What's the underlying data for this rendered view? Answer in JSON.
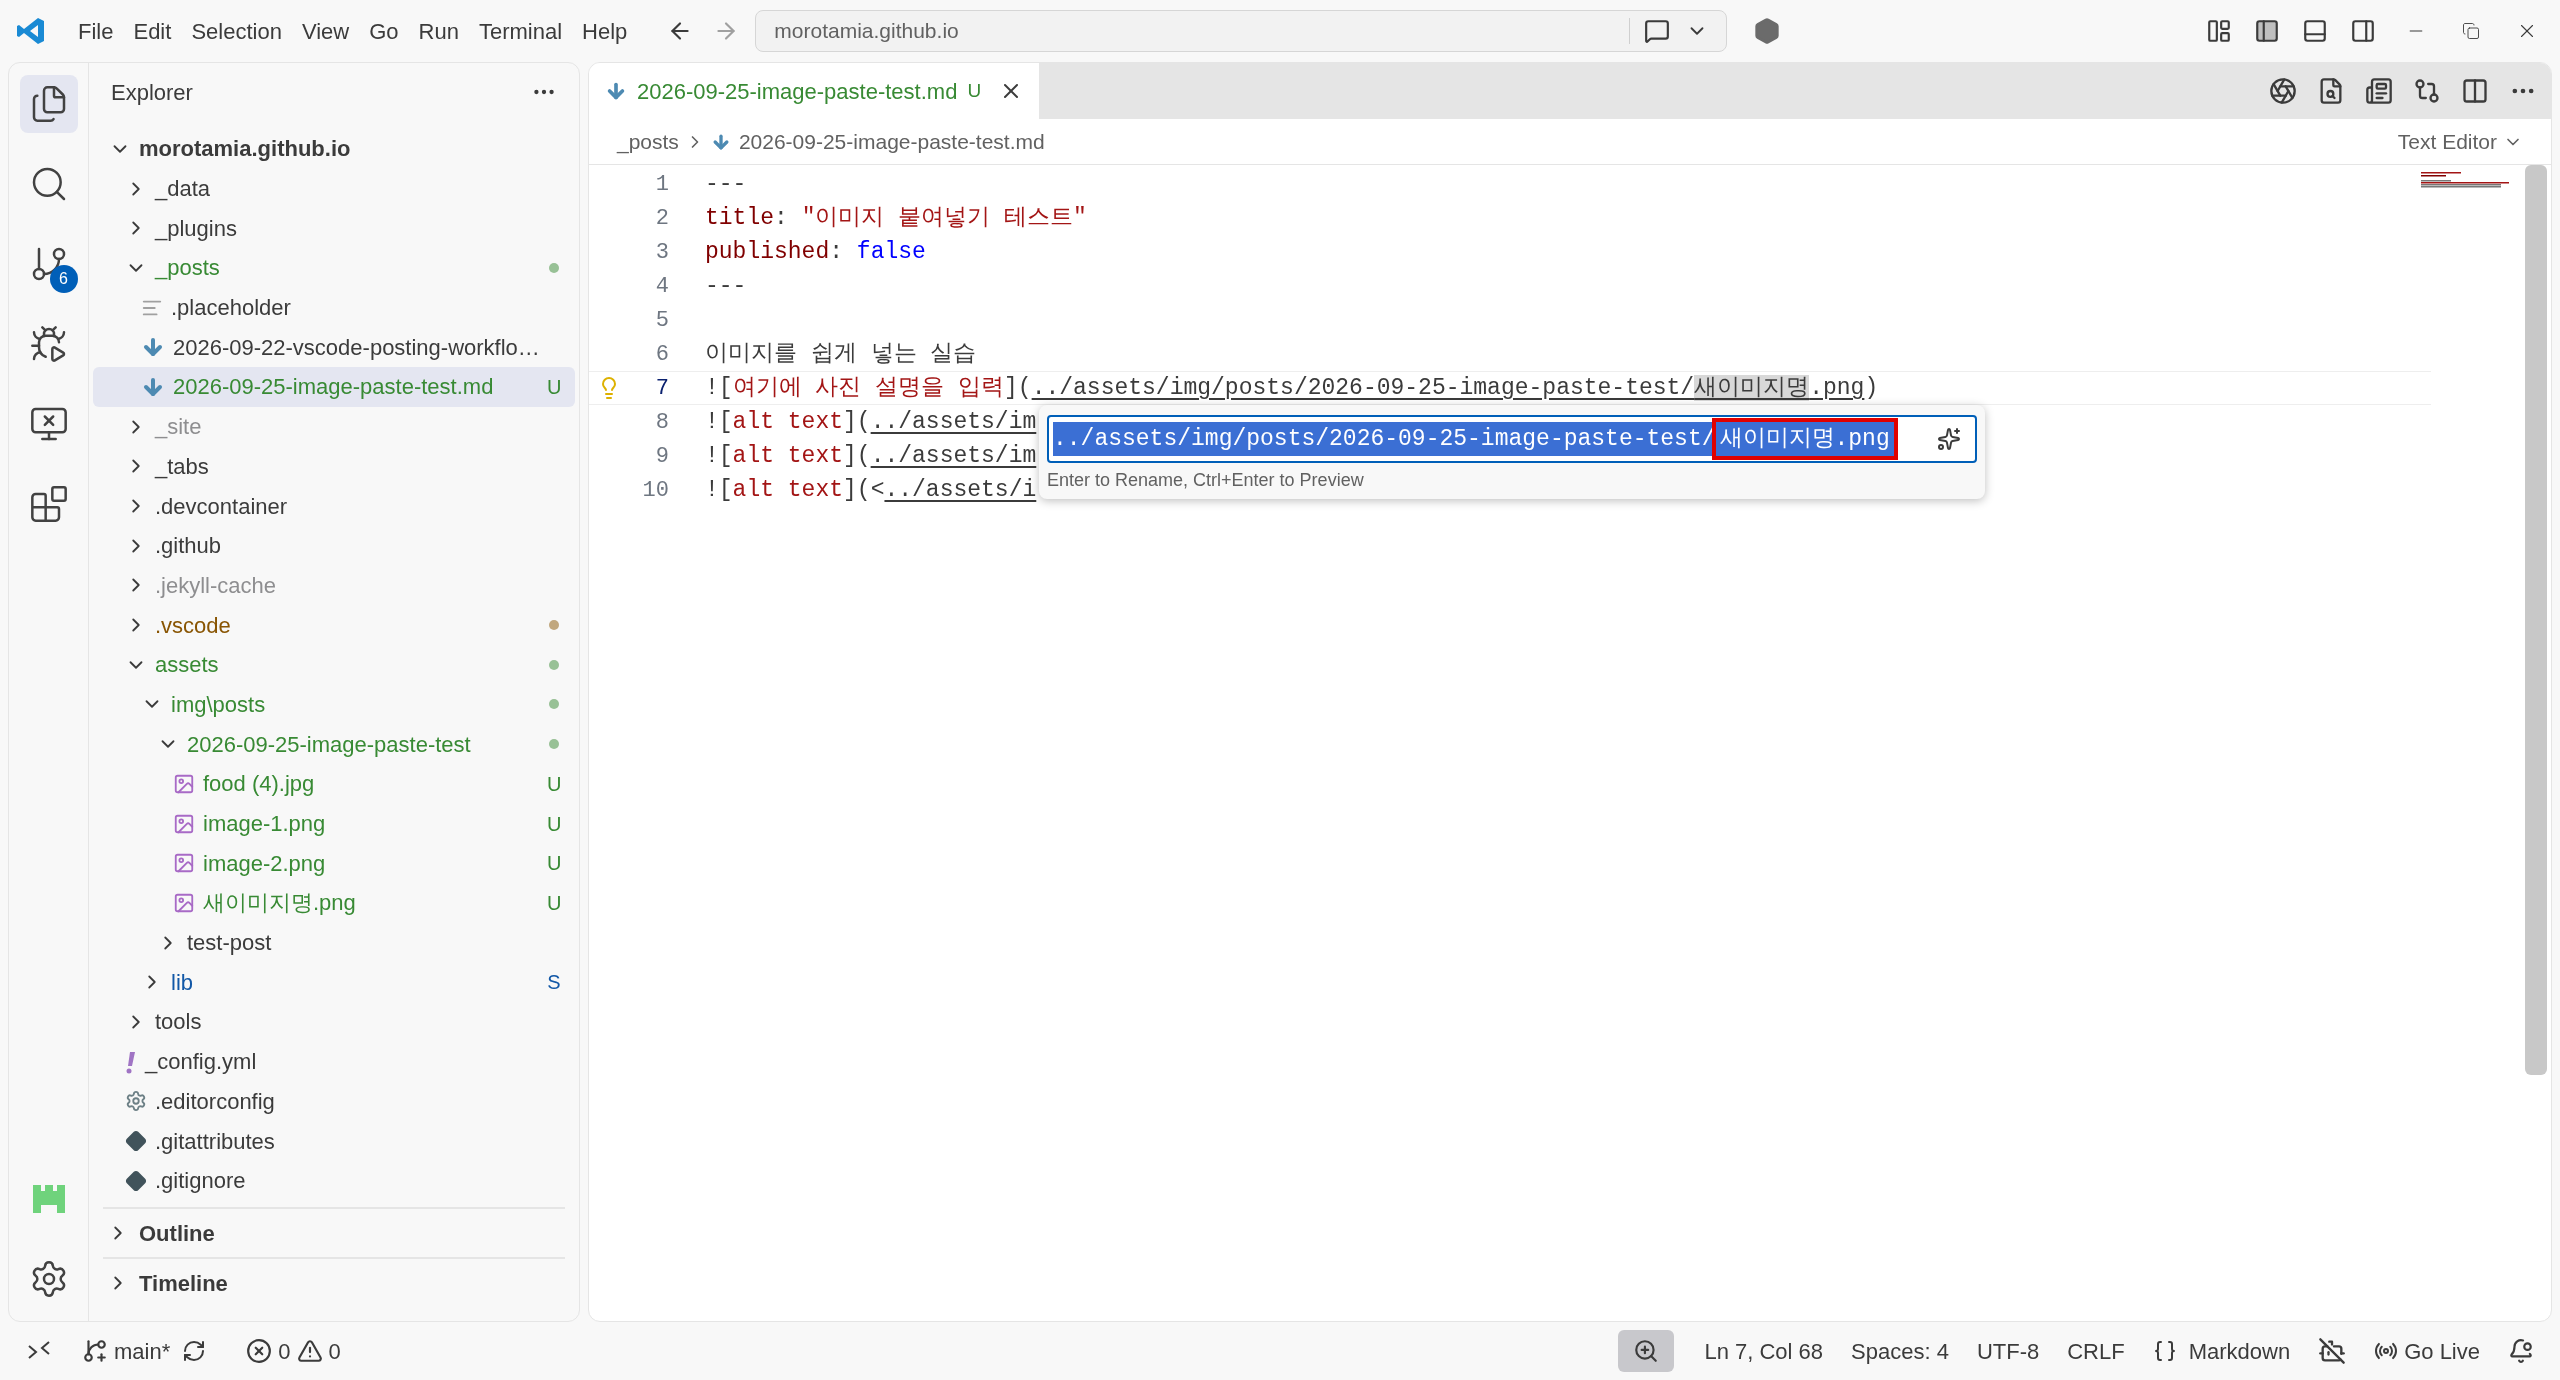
{
  "title_bar": {
    "menus": [
      "File",
      "Edit",
      "Selection",
      "View",
      "Go",
      "Run",
      "Terminal",
      "Help"
    ],
    "command_center": {
      "value": "morotamia.github.io"
    }
  },
  "activity_bar": {
    "items": [
      {
        "kind": "explorer",
        "selected": true
      },
      {
        "kind": "search",
        "selected": false
      },
      {
        "kind": "source-control",
        "selected": false,
        "badge": "6"
      },
      {
        "kind": "run-debug",
        "selected": false
      },
      {
        "kind": "remote",
        "selected": false
      },
      {
        "kind": "extensions",
        "selected": false
      }
    ]
  },
  "sidebar": {
    "title": "Explorer",
    "tree": [
      {
        "name": "morotamia.github.io",
        "kind": "root",
        "expanded": true,
        "selected": false,
        "children": [
          {
            "name": "_data",
            "kind": "folder",
            "expanded": false,
            "selected": false
          },
          {
            "name": "_plugins",
            "kind": "folder",
            "expanded": false,
            "selected": false
          },
          {
            "name": "_posts",
            "kind": "folder",
            "expanded": true,
            "selected": false,
            "color": "#388a34",
            "dot": true,
            "children": [
              {
                "name": ".placeholder",
                "kind": "text-file",
                "selected": false
              },
              {
                "name": "2026-09-22-vscode-posting-workflo…",
                "kind": "markdown-file",
                "selected": false
              },
              {
                "name": "2026-09-25-image-paste-test.md",
                "kind": "markdown-file",
                "selected": true,
                "color": "#388a34",
                "badge": "U"
              }
            ]
          },
          {
            "name": "_site",
            "kind": "folder",
            "expanded": false,
            "selected": false,
            "color": "#8e8e90"
          },
          {
            "name": "_tabs",
            "kind": "folder",
            "expanded": false,
            "selected": false
          },
          {
            "name": ".devcontainer",
            "kind": "folder",
            "expanded": false,
            "selected": false
          },
          {
            "name": ".github",
            "kind": "folder",
            "expanded": false,
            "selected": false
          },
          {
            "name": ".jekyll-cache",
            "kind": "folder",
            "expanded": false,
            "selected": false,
            "color": "#8e8e90"
          },
          {
            "name": ".vscode",
            "kind": "folder",
            "expanded": false,
            "selected": false,
            "color": "#895503",
            "dot": true
          },
          {
            "name": "assets",
            "kind": "folder",
            "expanded": true,
            "selected": false,
            "color": "#388a34",
            "dot": true,
            "children": [
              {
                "name": "img\\posts",
                "kind": "folder",
                "expanded": true,
                "selected": false,
                "color": "#388a34",
                "dot": true,
                "children": [
                  {
                    "name": "2026-09-25-image-paste-test",
                    "kind": "folder",
                    "expanded": true,
                    "selected": false,
                    "color": "#388a34",
                    "dot": true,
                    "children": [
                      {
                        "name": "food (4).jpg",
                        "kind": "image-file",
                        "selected": false,
                        "color": "#388a34",
                        "badge": "U"
                      },
                      {
                        "name": "image-1.png",
                        "kind": "image-file",
                        "selected": false,
                        "color": "#388a34",
                        "badge": "U"
                      },
                      {
                        "name": "image-2.png",
                        "kind": "image-file",
                        "selected": false,
                        "color": "#388a34",
                        "badge": "U"
                      },
                      {
                        "name": "새이미지명.png",
                        "kind": "image-file",
                        "selected": false,
                        "color": "#388a34",
                        "badge": "U"
                      }
                    ]
                  },
                  {
                    "name": "test-post",
                    "kind": "folder",
                    "expanded": false,
                    "selected": false
                  }
                ]
              },
              {
                "name": "lib",
                "kind": "folder",
                "expanded": false,
                "selected": false,
                "color": "#1258a7",
                "badge": "S"
              }
            ]
          },
          {
            "name": "tools",
            "kind": "folder",
            "expanded": false,
            "selected": false
          },
          {
            "name": "_config.yml",
            "kind": "yaml-file",
            "selected": false
          },
          {
            "name": ".editorconfig",
            "kind": "config-file",
            "selected": false
          },
          {
            "name": ".gitattributes",
            "kind": "git-file",
            "selected": false
          },
          {
            "name": ".gitignore",
            "kind": "git-file",
            "selected": false
          }
        ]
      }
    ],
    "sections": [
      {
        "title": "Outline",
        "expanded": false
      },
      {
        "title": "Timeline",
        "expanded": false
      }
    ]
  },
  "editor": {
    "tabs": [
      {
        "label": "2026-09-25-image-paste-test.md",
        "badge": "U",
        "selected": true
      }
    ],
    "breadcrumb": [
      "_posts",
      "2026-09-25-image-paste-test.md"
    ],
    "view_mode": "Text Editor",
    "lines": [
      {
        "number": "1",
        "active": false,
        "segments": [
          {
            "text": "---",
            "kind": "plain"
          }
        ]
      },
      {
        "number": "2",
        "active": false,
        "segments": [
          {
            "text": "title",
            "kind": "key"
          },
          {
            "text": ": ",
            "kind": "plain"
          },
          {
            "text": "\"이미지 붙여넣기 테스트\"",
            "kind": "string"
          }
        ]
      },
      {
        "number": "3",
        "active": false,
        "segments": [
          {
            "text": "published",
            "kind": "key"
          },
          {
            "text": ": ",
            "kind": "plain"
          },
          {
            "text": "false",
            "kind": "boolean"
          }
        ]
      },
      {
        "number": "4",
        "active": false,
        "segments": [
          {
            "text": "---",
            "kind": "plain"
          }
        ]
      },
      {
        "number": "5",
        "active": false
      },
      {
        "number": "6",
        "active": false,
        "segments": [
          {
            "text": "이미지를 쉽게 넣는 실습",
            "kind": "plain"
          }
        ]
      },
      {
        "number": "7",
        "active": true,
        "segments": [
          {
            "text": "![",
            "kind": "plain"
          },
          {
            "text": "여기에 사진 설명을 입력",
            "kind": "alt"
          },
          {
            "text": "](",
            "kind": "plain"
          },
          {
            "text": "../assets/img/posts/2026-09-25-image-paste-test/",
            "kind": "link"
          },
          {
            "text": "새이미지명",
            "kind": "match"
          },
          {
            "text": ".png",
            "kind": "link"
          },
          {
            "text": ")",
            "kind": "plain"
          }
        ]
      },
      {
        "number": "8",
        "active": false,
        "segments": [
          {
            "text": "![",
            "kind": "plain"
          },
          {
            "text": "alt text",
            "kind": "alt"
          },
          {
            "text": "](",
            "kind": "plain"
          },
          {
            "text": "../assets/im",
            "kind": "link"
          }
        ]
      },
      {
        "number": "9",
        "active": false,
        "segments": [
          {
            "text": "![",
            "kind": "plain"
          },
          {
            "text": "alt text",
            "kind": "alt"
          },
          {
            "text": "](",
            "kind": "plain"
          },
          {
            "text": "../assets/im",
            "kind": "link"
          }
        ]
      },
      {
        "number": "10",
        "active": false,
        "segments": [
          {
            "text": "![",
            "kind": "plain"
          },
          {
            "text": "alt text",
            "kind": "alt"
          },
          {
            "text": "](<",
            "kind": "plain"
          },
          {
            "text": "../assets/i",
            "kind": "link"
          }
        ]
      }
    ],
    "rename": {
      "value_path": "../assets/img/posts/2026-09-25-image-paste-test/",
      "value_name": "새이미지명.png",
      "selected": true,
      "annotated": true,
      "hint": "Enter to Rename, Ctrl+Enter to Preview"
    }
  },
  "status_bar": {
    "branch": "main*",
    "errors": "0",
    "warnings": "0",
    "items": [
      "Ln 7, Col 68",
      "Spaces: 4",
      "UTF-8",
      "CRLF"
    ],
    "language": "Markdown",
    "go_live": "Go Live"
  }
}
